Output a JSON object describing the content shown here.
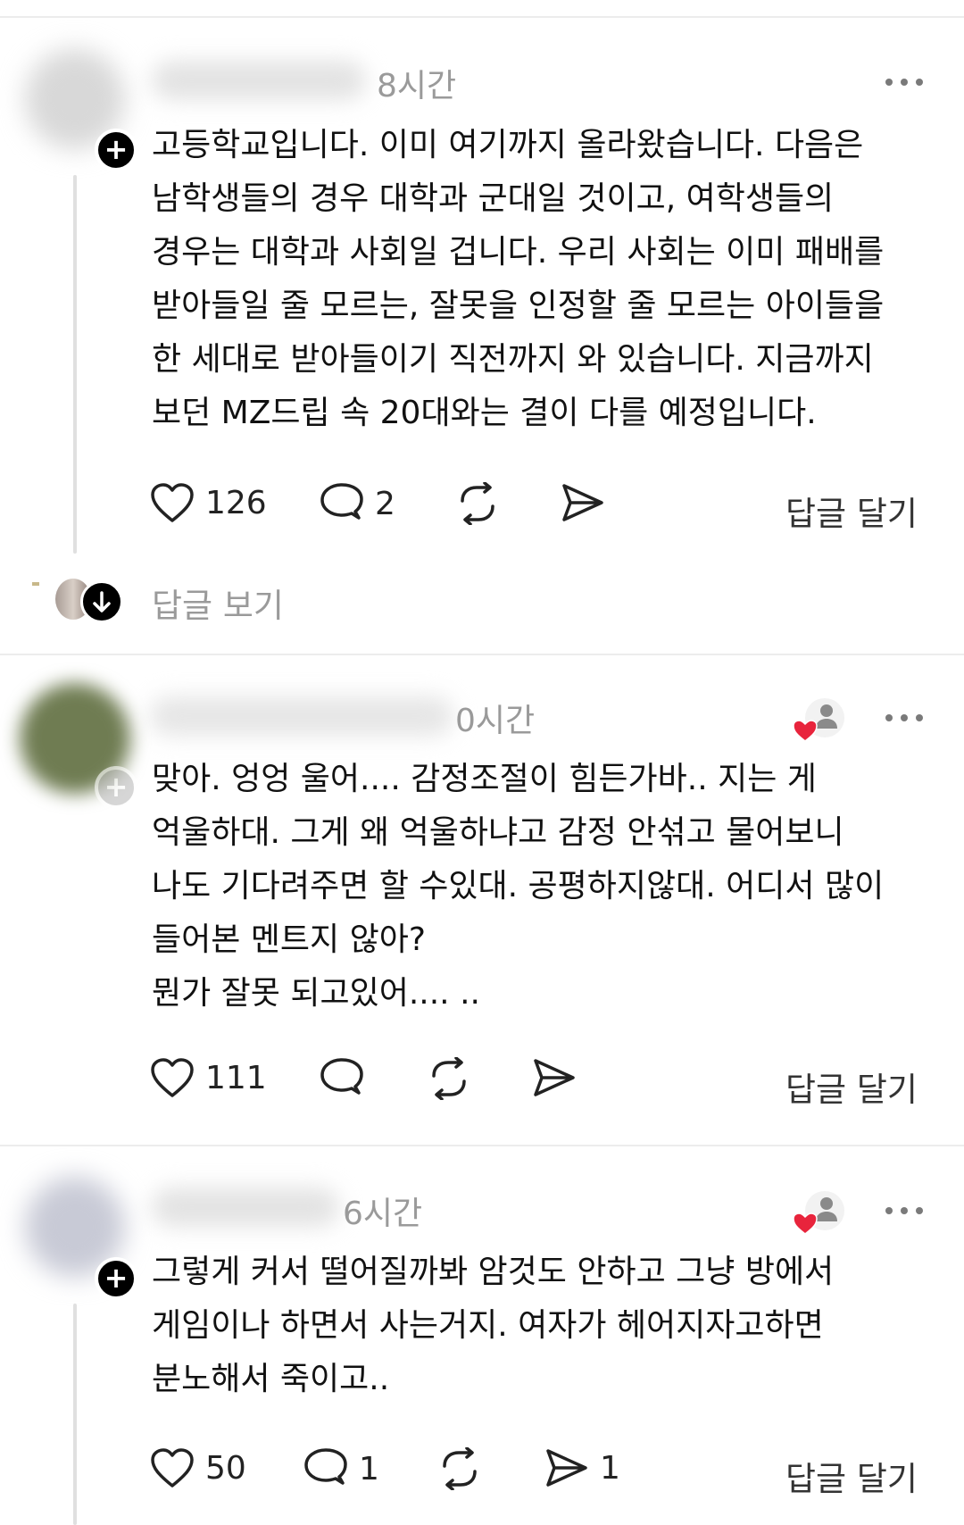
{
  "comments": [
    {
      "time": "8시간",
      "text": "고등학교입니다. 이미 여기까지 올라왔습니다. 다음은\n남학생들의 경우 대학과 군대일 것이고, 여학생들의\n경우는 대학과 사회일 겁니다. 우리 사회는 이미 패배를\n받아들일 줄 모르는, 잘못을 인정할 줄 모르는 아이들을\n한 세대로 받아들이기 직전까지 와 있습니다. 지금까지\n보던 MZ드립 속 20대와는 결이 다를 예정입니다.",
      "likes": "126",
      "comments": "2",
      "shares": "",
      "reply_label": "답글 달기",
      "view_replies": "답글 보기"
    },
    {
      "time": "0시간",
      "text": "맞아. 엉엉 울어.... 감정조절이 힘든가바.. 지는 게\n억울하대. 그게 왜 억울하냐고 감정 안섞고 물어보니\n나도 기다려주면 할 수있대. 공평하지않대. 어디서 많이\n들어본 멘트지 않아?\n뭔가 잘못 되고있어.... ..",
      "likes": "111",
      "comments": "",
      "shares": "",
      "reply_label": "답글 달기"
    },
    {
      "time": "6시간",
      "text": "그렇게 커서 떨어질까봐 암것도 안하고 그냥 방에서\n게임이나 하면서 사는거지. 여자가 헤어지자고하면\n분노해서 죽이고..",
      "likes": "50",
      "comments": "1",
      "shares": "1",
      "reply_label": "답글 달기"
    }
  ],
  "colors": {
    "text": "#111111",
    "muted": "#9a9a9a",
    "heart_red": "#e8243c"
  }
}
